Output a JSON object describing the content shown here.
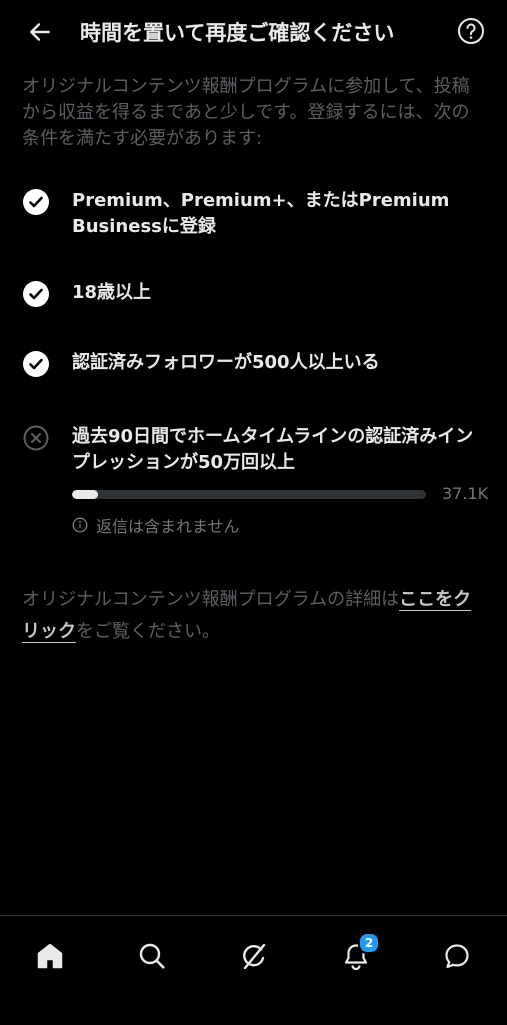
{
  "header": {
    "title": "時間を置いて再度ご確認ください"
  },
  "intro": {
    "text": "オリジナルコンテンツ報酬プログラムに参加して、投稿から収益を得るまであと少しです。登録するには、次の条件を満たす必要があります:"
  },
  "requirements": [
    {
      "label": "Premium、Premium+、またはPremium Businessに登録",
      "status": "met",
      "icon": "check-circle-icon"
    },
    {
      "label": "18歳以上",
      "status": "met",
      "icon": "check-circle-icon"
    },
    {
      "label": "認証済みフォロワーが500人以上いる",
      "status": "met",
      "icon": "check-circle-icon"
    },
    {
      "label": "過去90日間でホームタイムラインの認証済みインプレッションが50万回以上",
      "status": "unmet",
      "icon": "x-circle-icon"
    }
  ],
  "progress": {
    "current_label": "37.1K",
    "current": 37100,
    "target": 500000,
    "fraction": 0.0742
  },
  "note": {
    "text": "返信は含まれません",
    "icon": "info-icon"
  },
  "footer": {
    "text_before": "オリジナルコンテンツ報酬プログラムの詳細は",
    "link_text": "ここをクリック",
    "text_after": "をご覧ください。"
  },
  "nav": {
    "items": [
      {
        "name": "home",
        "icon": "home-icon"
      },
      {
        "name": "search",
        "icon": "search-icon"
      },
      {
        "name": "grok",
        "icon": "grok-icon"
      },
      {
        "name": "notifications",
        "icon": "bell-icon",
        "badge": "2"
      },
      {
        "name": "messages",
        "icon": "message-icon"
      }
    ]
  },
  "colors": {
    "background": "#000000",
    "text_primary": "#e7e9ea",
    "text_secondary": "#5b5f63",
    "badge": "#1d9bf0"
  }
}
